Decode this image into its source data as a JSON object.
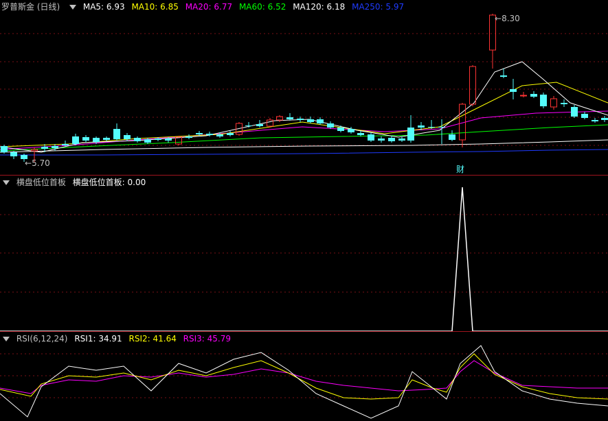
{
  "panes": {
    "main": {
      "title": "罗普斯金 (日线)",
      "ma": [
        {
          "label": "MA5: 6.93",
          "color": "#ffffff"
        },
        {
          "label": "MA10: 6.85",
          "color": "#ffff00"
        },
        {
          "label": "MA20: 6.77",
          "color": "#ff00ff"
        },
        {
          "label": "MA60: 6.52",
          "color": "#00ff00"
        },
        {
          "label": "MA120: 6.18",
          "color": "#ffffff"
        },
        {
          "label": "MA250: 5.97",
          "color": "#1f3bff"
        }
      ],
      "high_label": "8.30",
      "low_label": "5.70",
      "event_tag": "财"
    },
    "indicator": {
      "title": "横盘低位首板",
      "value_label": "横盘低位首板: 0.00"
    },
    "rsi": {
      "title": "RSI(6,12,24)",
      "series": [
        {
          "label": "RSI1: 34.91",
          "color": "#ffffff"
        },
        {
          "label": "RSI2: 41.64",
          "color": "#ffff00"
        },
        {
          "label": "RSI3: 45.79",
          "color": "#ff00ff"
        }
      ]
    }
  },
  "colors": {
    "up": "#ff3333",
    "down": "#54fcfc",
    "separator": "#a0141e",
    "grid": "#7a0f16"
  }
}
